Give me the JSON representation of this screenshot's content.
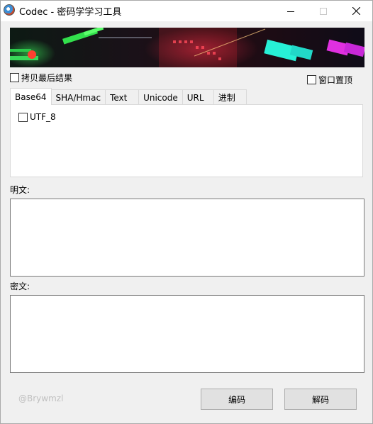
{
  "window": {
    "title": "Codec - 密码学学习工具",
    "app_icon": "codec-app-icon",
    "controls": [
      "minimize-icon",
      "maximize-icon",
      "close-icon"
    ]
  },
  "options": {
    "copy_last_result": {
      "label": "拷贝最后结果",
      "checked": false
    },
    "always_on_top": {
      "label": "窗口置顶",
      "checked": false
    }
  },
  "tabs": [
    {
      "label": "Base64",
      "active": true
    },
    {
      "label": "SHA/Hmac",
      "active": false
    },
    {
      "label": "Text",
      "active": false
    },
    {
      "label": "Unicode",
      "active": false
    },
    {
      "label": "URL",
      "active": false
    },
    {
      "label": "进制",
      "active": false
    }
  ],
  "base64_panel": {
    "utf8": {
      "label": "UTF_8",
      "checked": false
    }
  },
  "plaintext": {
    "label": "明文:",
    "value": ""
  },
  "ciphertext": {
    "label": "密文:",
    "value": ""
  },
  "footer": {
    "watermark": "@Brywmzl",
    "encode_label": "编码",
    "decode_label": "解码"
  },
  "colors": {
    "window_bg": "#f0f0f0",
    "button_bg": "#e1e1e1",
    "watermark": "#c0c0c0"
  }
}
